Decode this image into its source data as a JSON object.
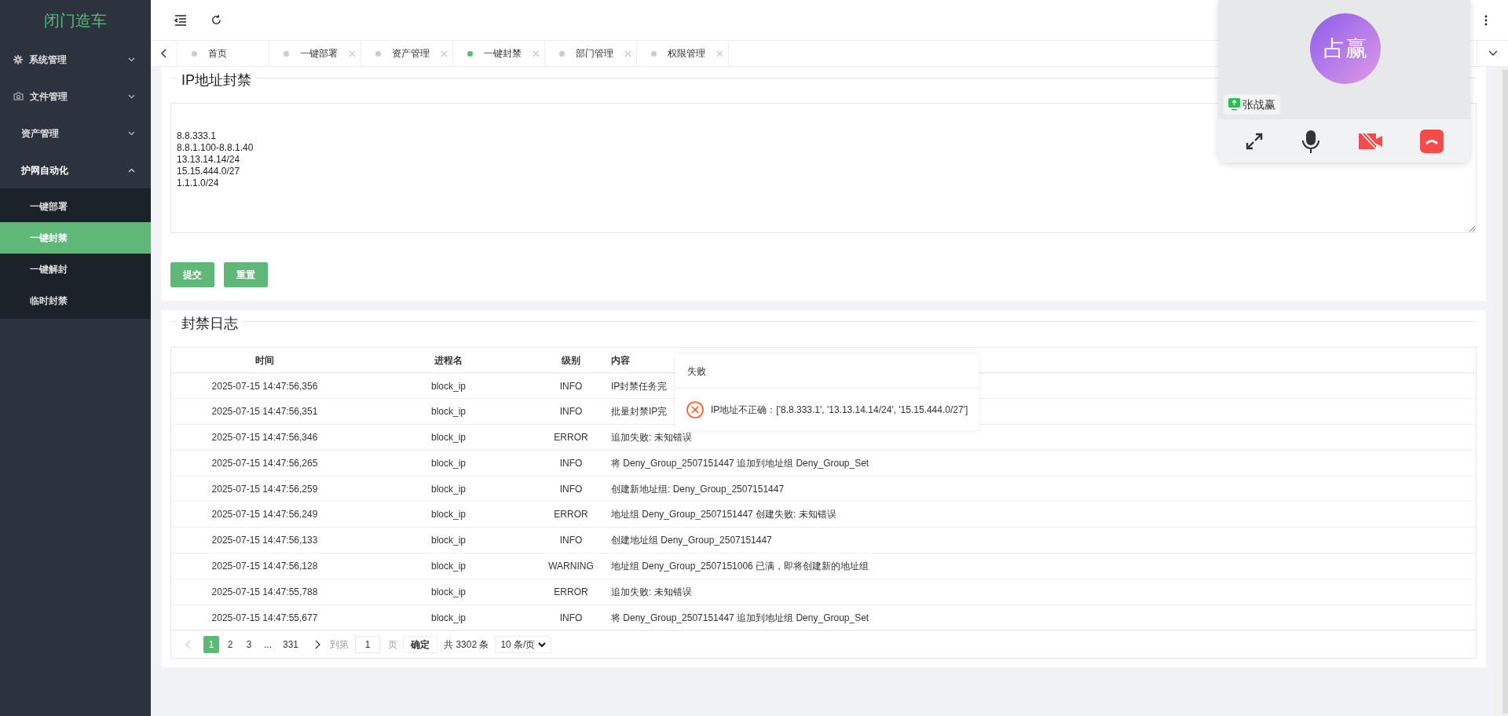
{
  "sidebar": {
    "logo": "闭门造车",
    "items": [
      {
        "label": "系统管理",
        "expanded": false
      },
      {
        "label": "文件管理",
        "expanded": false
      },
      {
        "label": "资产管理",
        "expanded": false
      },
      {
        "label": "护网自动化",
        "expanded": true,
        "children": [
          {
            "label": "一键部署",
            "selected": false
          },
          {
            "label": "一键封禁",
            "selected": true
          },
          {
            "label": "一键解封",
            "selected": false
          },
          {
            "label": "临时封禁",
            "selected": false
          }
        ]
      }
    ]
  },
  "tabs": [
    {
      "label": "首页",
      "selected": false,
      "closable": false
    },
    {
      "label": "一键部署",
      "selected": false,
      "closable": true
    },
    {
      "label": "资产管理",
      "selected": false,
      "closable": true
    },
    {
      "label": "一键封禁",
      "selected": true,
      "closable": true
    },
    {
      "label": "部门管理",
      "selected": false,
      "closable": true
    },
    {
      "label": "权限管理",
      "selected": false,
      "closable": true
    }
  ],
  "ip_form": {
    "title": "IP地址封禁",
    "value": "\n\n8.8.333.1\n8.8.1.100-8.8.1.40\n13.13.14.14/24\n15.15.444.0/27\n1.1.1.0/24",
    "buttons": [
      "提交",
      "重置"
    ]
  },
  "log": {
    "title": "封禁日志",
    "columns": [
      "时间",
      "进程名",
      "级别",
      "内容"
    ],
    "rows": [
      [
        "2025-07-15 14:47:56,356",
        "block_ip",
        "INFO",
        "IP封禁任务完"
      ],
      [
        "2025-07-15 14:47:56,351",
        "block_ip",
        "INFO",
        "批量封禁IP完"
      ],
      [
        "2025-07-15 14:47:56,346",
        "block_ip",
        "ERROR",
        "追加失败: 未知错误"
      ],
      [
        "2025-07-15 14:47:56,265",
        "block_ip",
        "INFO",
        "将 Deny_Group_2507151447 追加到地址组 Deny_Group_Set"
      ],
      [
        "2025-07-15 14:47:56,259",
        "block_ip",
        "INFO",
        "创建新地址组: Deny_Group_2507151447"
      ],
      [
        "2025-07-15 14:47:56,249",
        "block_ip",
        "ERROR",
        "地址组 Deny_Group_2507151447 创建失败: 未知错误"
      ],
      [
        "2025-07-15 14:47:56,133",
        "block_ip",
        "INFO",
        "创建地址组 Deny_Group_2507151447"
      ],
      [
        "2025-07-15 14:47:56,128",
        "block_ip",
        "WARNING",
        "地址组 Deny_Group_2507151006 已满，即将创建新的地址组"
      ],
      [
        "2025-07-15 14:47:55,788",
        "block_ip",
        "ERROR",
        "追加失败: 未知错误"
      ],
      [
        "2025-07-15 14:47:55,677",
        "block_ip",
        "INFO",
        "将 Deny_Group_2507151447 追加到地址组 Deny_Group_Set"
      ]
    ],
    "pagination": {
      "pages": [
        {
          "label": "1",
          "selected": true
        },
        {
          "label": "2",
          "selected": false
        },
        {
          "label": "3",
          "selected": false
        },
        {
          "label": "...",
          "selected": false
        },
        {
          "label": "331",
          "selected": false
        }
      ],
      "goto_label": "到第",
      "goto_value": "1",
      "page_unit": "页",
      "confirm": "确定",
      "total": "共 3302 条",
      "page_size": "10 条/页"
    }
  },
  "toast": {
    "title": "失败",
    "message": "IP地址不正确：['8.8.333.1', '13.13.14.14/24', '15.15.444.0/27']"
  },
  "call": {
    "avatar": "占赢",
    "name": "张战赢"
  }
}
